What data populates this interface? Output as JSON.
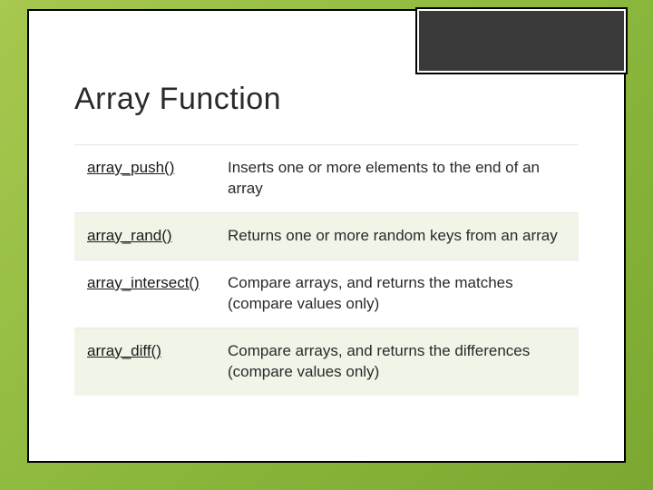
{
  "slide": {
    "title": "Array Function",
    "rows": [
      {
        "name": "array_push()",
        "desc": "Inserts one or more elements to the end of an array"
      },
      {
        "name": "array_rand()",
        "desc": " Returns one or more random keys from an array"
      },
      {
        "name": "array_intersect()",
        "desc": "Compare arrays, and returns the matches (compare values only)"
      },
      {
        "name": "array_diff()",
        "desc": "Compare arrays, and returns the differences (compare values only)"
      }
    ]
  }
}
